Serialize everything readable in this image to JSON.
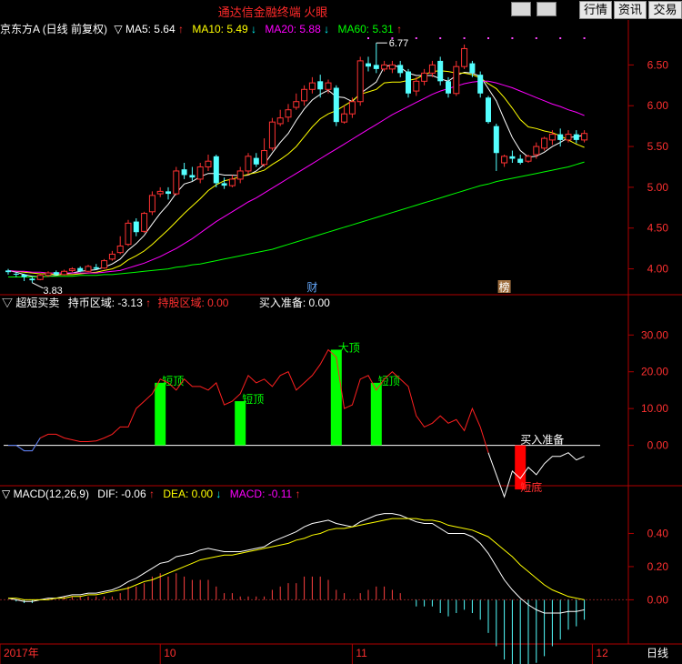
{
  "app": {
    "title": "通达信金融终端  火眼",
    "buttons": [
      "行情",
      "资讯",
      "交易"
    ]
  },
  "chart_data": [
    {
      "type": "candlestick",
      "panel": "price",
      "header": {
        "name": "京东方A",
        "period": "(日线 前复权)",
        "ma5": "MA5: 5.64",
        "ma10": "MA10: 5.49",
        "ma20": "MA20: 5.88",
        "ma60": "MA60: 5.31"
      },
      "ylim": [
        3.75,
        6.85
      ],
      "yticks": [
        "6.50",
        "6.00",
        "5.50",
        "5.00",
        "4.50",
        "4.00"
      ],
      "ytick_values": [
        6.5,
        6.0,
        5.5,
        5.0,
        4.5,
        4.0
      ],
      "high_label": "6.77",
      "low_label": "3.83",
      "markers": [
        "财",
        "榜"
      ],
      "candles": [
        [
          3.98,
          3.96,
          4.0,
          3.93
        ],
        [
          3.94,
          3.93,
          3.96,
          3.9
        ],
        [
          3.93,
          3.9,
          3.94,
          3.85
        ],
        [
          3.88,
          3.86,
          3.9,
          3.83
        ],
        [
          3.87,
          3.92,
          3.94,
          3.86
        ],
        [
          3.92,
          3.95,
          3.97,
          3.9
        ],
        [
          3.96,
          3.93,
          3.98,
          3.92
        ],
        [
          3.93,
          3.97,
          3.99,
          3.92
        ],
        [
          3.98,
          4.0,
          4.02,
          3.96
        ],
        [
          4.01,
          3.97,
          4.03,
          3.96
        ],
        [
          3.97,
          4.03,
          4.05,
          3.96
        ],
        [
          4.02,
          4.0,
          4.06,
          3.99
        ],
        [
          4.01,
          4.1,
          4.12,
          4.0
        ],
        [
          4.12,
          4.18,
          4.22,
          4.1
        ],
        [
          4.2,
          4.28,
          4.4,
          4.18
        ],
        [
          4.3,
          4.56,
          4.6,
          4.28
        ],
        [
          4.58,
          4.45,
          4.62,
          4.4
        ],
        [
          4.46,
          4.68,
          4.7,
          4.44
        ],
        [
          4.7,
          4.9,
          4.95,
          4.66
        ],
        [
          4.92,
          4.95,
          5.0,
          4.88
        ],
        [
          4.95,
          4.92,
          5.0,
          4.85
        ],
        [
          4.92,
          5.2,
          5.25,
          4.9
        ],
        [
          5.22,
          5.15,
          5.3,
          5.1
        ],
        [
          5.15,
          5.12,
          5.25,
          5.08
        ],
        [
          5.1,
          5.25,
          5.3,
          5.05
        ],
        [
          5.25,
          5.32,
          5.4,
          5.2
        ],
        [
          5.38,
          5.05,
          5.4,
          5.0
        ],
        [
          5.05,
          5.02,
          5.12,
          4.98
        ],
        [
          5.02,
          5.1,
          5.15,
          5.0
        ],
        [
          5.1,
          5.2,
          5.25,
          5.05
        ],
        [
          5.2,
          5.38,
          5.42,
          5.15
        ],
        [
          5.36,
          5.28,
          5.42,
          5.25
        ],
        [
          5.28,
          5.45,
          5.6,
          5.25
        ],
        [
          5.48,
          5.8,
          5.85,
          5.45
        ],
        [
          5.78,
          5.85,
          5.95,
          5.75
        ],
        [
          5.86,
          5.95,
          6.02,
          5.8
        ],
        [
          5.98,
          6.05,
          6.15,
          5.95
        ],
        [
          6.06,
          6.2,
          6.25,
          6.0
        ],
        [
          6.2,
          6.28,
          6.35,
          6.15
        ],
        [
          6.3,
          6.2,
          6.38,
          6.1
        ],
        [
          6.2,
          6.28,
          6.32,
          6.15
        ],
        [
          6.22,
          5.8,
          6.25,
          5.75
        ],
        [
          5.8,
          5.9,
          6.0,
          5.78
        ],
        [
          5.9,
          6.05,
          6.1,
          5.85
        ],
        [
          6.05,
          6.55,
          6.6,
          6.0
        ],
        [
          6.52,
          6.48,
          6.6,
          6.42
        ],
        [
          6.5,
          6.45,
          6.77,
          6.4
        ],
        [
          6.45,
          6.5,
          6.55,
          6.42
        ],
        [
          6.45,
          6.5,
          6.55,
          6.4
        ],
        [
          6.5,
          6.4,
          6.55,
          6.35
        ],
        [
          6.42,
          6.15,
          6.45,
          6.1
        ],
        [
          6.18,
          6.3,
          6.35,
          6.12
        ],
        [
          6.3,
          6.4,
          6.45,
          6.25
        ],
        [
          6.4,
          6.5,
          6.55,
          6.35
        ],
        [
          6.55,
          6.3,
          6.6,
          6.25
        ],
        [
          6.3,
          6.15,
          6.35,
          6.1
        ],
        [
          6.15,
          6.48,
          6.55,
          6.12
        ],
        [
          6.48,
          6.7,
          6.75,
          6.45
        ],
        [
          6.52,
          6.4,
          6.55,
          6.35
        ],
        [
          6.38,
          6.15,
          6.42,
          6.1
        ],
        [
          6.1,
          5.8,
          6.12,
          5.78
        ],
        [
          5.75,
          5.42,
          5.78,
          5.2
        ],
        [
          5.3,
          5.38,
          5.4,
          5.25
        ],
        [
          5.38,
          5.35,
          5.45,
          5.3
        ],
        [
          5.35,
          5.3,
          5.4,
          5.28
        ],
        [
          5.32,
          5.38,
          5.4,
          5.3
        ],
        [
          5.4,
          5.5,
          5.55,
          5.35
        ],
        [
          5.48,
          5.6,
          5.62,
          5.45
        ],
        [
          5.58,
          5.65,
          5.7,
          5.52
        ],
        [
          5.65,
          5.58,
          5.72,
          5.5
        ],
        [
          5.58,
          5.65,
          5.7,
          5.55
        ],
        [
          5.65,
          5.58,
          5.7,
          5.54
        ],
        [
          5.58,
          5.66,
          5.7,
          5.55
        ]
      ],
      "series": [
        {
          "name": "MA5",
          "color": "#ffffff",
          "values": [
            3.98,
            3.96,
            3.93,
            3.91,
            3.9,
            3.91,
            3.92,
            3.94,
            3.95,
            3.97,
            3.98,
            3.99,
            4.02,
            4.06,
            4.12,
            4.23,
            4.31,
            4.41,
            4.55,
            4.68,
            4.79,
            4.93,
            5.04,
            5.07,
            5.13,
            5.17,
            5.17,
            5.15,
            5.15,
            5.14,
            5.15,
            5.2,
            5.28,
            5.42,
            5.55,
            5.66,
            5.82,
            5.96,
            6.07,
            6.14,
            6.19,
            6.11,
            6.1,
            6.05,
            6.15,
            6.22,
            6.29,
            6.48,
            6.5,
            6.47,
            6.4,
            6.37,
            6.37,
            6.37,
            6.33,
            6.3,
            6.37,
            6.41,
            6.4,
            6.36,
            6.21,
            6.06,
            5.83,
            5.61,
            5.45,
            5.37,
            5.38,
            5.43,
            5.5,
            5.55,
            5.61,
            5.62,
            5.64
          ]
        },
        {
          "name": "MA10",
          "color": "#ffff00",
          "values": [
            3.98,
            3.97,
            3.96,
            3.95,
            3.94,
            3.94,
            3.93,
            3.93,
            3.93,
            3.94,
            3.95,
            3.96,
            3.98,
            4.0,
            4.04,
            4.11,
            4.16,
            4.22,
            4.3,
            4.39,
            4.48,
            4.58,
            4.68,
            4.77,
            4.86,
            4.96,
            5.03,
            5.08,
            5.1,
            5.13,
            5.16,
            5.18,
            5.21,
            5.28,
            5.34,
            5.41,
            5.5,
            5.62,
            5.74,
            5.84,
            5.9,
            5.94,
            6.0,
            6.06,
            6.14,
            6.17,
            6.2,
            6.28,
            6.29,
            6.29,
            6.31,
            6.33,
            6.38,
            6.42,
            6.43,
            6.42,
            6.4,
            6.4,
            6.38,
            6.34,
            6.27,
            6.21,
            6.1,
            5.97,
            5.83,
            5.74,
            5.72,
            5.69,
            5.67,
            5.63,
            5.58,
            5.53,
            5.49
          ]
        },
        {
          "name": "MA20",
          "color": "#ff00ff",
          "values": [
            3.98,
            3.97,
            3.97,
            3.96,
            3.96,
            3.95,
            3.95,
            3.95,
            3.95,
            3.95,
            3.95,
            3.95,
            3.96,
            3.97,
            3.98,
            4.01,
            4.04,
            4.07,
            4.11,
            4.15,
            4.2,
            4.25,
            4.31,
            4.37,
            4.44,
            4.51,
            4.58,
            4.64,
            4.7,
            4.76,
            4.82,
            4.87,
            4.93,
            4.99,
            5.05,
            5.11,
            5.17,
            5.23,
            5.29,
            5.35,
            5.41,
            5.47,
            5.53,
            5.59,
            5.65,
            5.71,
            5.77,
            5.83,
            5.89,
            5.94,
            5.99,
            6.04,
            6.09,
            6.14,
            6.18,
            6.21,
            6.24,
            6.27,
            6.29,
            6.3,
            6.3,
            6.28,
            6.25,
            6.22,
            6.18,
            6.14,
            6.1,
            6.06,
            6.02,
            5.99,
            5.95,
            5.92,
            5.88
          ]
        },
        {
          "name": "MA60",
          "color": "#00ff00",
          "values": [
            3.9,
            3.9,
            3.9,
            3.9,
            3.9,
            3.91,
            3.91,
            3.91,
            3.91,
            3.92,
            3.92,
            3.92,
            3.93,
            3.93,
            3.94,
            3.95,
            3.96,
            3.97,
            3.98,
            3.99,
            4.0,
            4.02,
            4.03,
            4.05,
            4.06,
            4.08,
            4.1,
            4.12,
            4.14,
            4.16,
            4.18,
            4.2,
            4.22,
            4.24,
            4.27,
            4.3,
            4.33,
            4.36,
            4.39,
            4.42,
            4.45,
            4.48,
            4.51,
            4.54,
            4.57,
            4.6,
            4.63,
            4.66,
            4.69,
            4.72,
            4.75,
            4.78,
            4.81,
            4.84,
            4.87,
            4.9,
            4.93,
            4.96,
            4.99,
            5.02,
            5.04,
            5.07,
            5.09,
            5.11,
            5.13,
            5.15,
            5.17,
            5.19,
            5.21,
            5.23,
            5.25,
            5.28,
            5.31
          ]
        }
      ]
    },
    {
      "type": "line-bar",
      "panel": "indicator",
      "header": {
        "name": "超短买卖",
        "holding": "持币区域: -3.13",
        "share_zone": "持股区域: 0.00",
        "buy_ready": "买入准备: 0.00"
      },
      "ylim": [
        -10,
        37
      ],
      "yticks": [
        "30.00",
        "20.00",
        "10.00",
        "0.00"
      ],
      "ytick_values": [
        30,
        20,
        10,
        0
      ],
      "line": [
        0,
        0,
        -1.5,
        -1.5,
        2,
        3,
        3,
        2,
        1.5,
        1,
        1,
        1.2,
        2,
        3,
        5,
        5,
        10,
        12,
        14,
        18,
        17,
        15,
        18,
        16,
        16,
        15,
        17,
        11,
        12,
        14,
        19,
        17,
        18,
        16,
        19,
        20,
        15,
        17,
        19,
        22,
        26,
        24,
        10,
        11,
        18,
        19,
        15,
        18,
        20,
        18,
        16,
        8,
        5,
        6,
        8,
        6,
        7,
        4,
        10,
        5,
        -2,
        -8,
        -14,
        -7,
        -9,
        -6,
        -8,
        -5,
        -3,
        -3,
        -2,
        -4,
        -3
      ],
      "bars": [
        {
          "index": 19,
          "value": 17,
          "color": "#00ff00",
          "label": "短顶"
        },
        {
          "index": 29,
          "value": 12,
          "color": "#00ff00",
          "label": "短顶"
        },
        {
          "index": 41,
          "value": 26,
          "color": "#00ff00",
          "label": "大顶"
        },
        {
          "index": 46,
          "value": 17,
          "color": "#00ff00",
          "label": "短顶"
        },
        {
          "index": 64,
          "value": -12,
          "color": "#ff0000",
          "label": "短底"
        }
      ],
      "annotations": [
        "买入准备"
      ]
    },
    {
      "type": "macd",
      "panel": "macd",
      "header": {
        "name": "MACD(12,26,9)",
        "dif": "DIF: -0.06",
        "dea": "DEA: 0.00",
        "macd": "MACD: -0.11"
      },
      "ylim": [
        -0.25,
        0.6
      ],
      "yticks": [
        "0.40",
        "0.20",
        "0.00"
      ],
      "ytick_values": [
        0.4,
        0.2,
        0.0
      ],
      "dif": [
        0.01,
        0.0,
        -0.01,
        -0.01,
        0.0,
        0.01,
        0.01,
        0.02,
        0.03,
        0.03,
        0.04,
        0.04,
        0.05,
        0.06,
        0.08,
        0.11,
        0.13,
        0.16,
        0.19,
        0.22,
        0.23,
        0.26,
        0.27,
        0.28,
        0.3,
        0.31,
        0.3,
        0.29,
        0.29,
        0.29,
        0.3,
        0.31,
        0.32,
        0.35,
        0.37,
        0.39,
        0.41,
        0.44,
        0.46,
        0.47,
        0.48,
        0.46,
        0.45,
        0.44,
        0.47,
        0.49,
        0.51,
        0.52,
        0.52,
        0.51,
        0.49,
        0.47,
        0.46,
        0.46,
        0.43,
        0.4,
        0.4,
        0.4,
        0.38,
        0.34,
        0.28,
        0.2,
        0.12,
        0.06,
        0.01,
        -0.03,
        -0.06,
        -0.08,
        -0.08,
        -0.08,
        -0.07,
        -0.07,
        -0.06
      ],
      "dea": [
        0.01,
        0.01,
        0.0,
        0.0,
        0.0,
        0.0,
        0.01,
        0.01,
        0.02,
        0.02,
        0.03,
        0.03,
        0.04,
        0.05,
        0.06,
        0.07,
        0.09,
        0.11,
        0.12,
        0.14,
        0.16,
        0.18,
        0.2,
        0.22,
        0.24,
        0.25,
        0.26,
        0.27,
        0.27,
        0.28,
        0.29,
        0.3,
        0.31,
        0.32,
        0.33,
        0.34,
        0.36,
        0.37,
        0.39,
        0.4,
        0.42,
        0.43,
        0.43,
        0.44,
        0.45,
        0.46,
        0.47,
        0.48,
        0.49,
        0.49,
        0.49,
        0.49,
        0.48,
        0.48,
        0.47,
        0.45,
        0.44,
        0.43,
        0.42,
        0.4,
        0.38,
        0.34,
        0.3,
        0.26,
        0.21,
        0.17,
        0.13,
        0.09,
        0.06,
        0.04,
        0.02,
        0.01,
        0.0
      ],
      "macd": [
        0.0,
        -0.01,
        -0.02,
        -0.02,
        0.0,
        0.01,
        0.0,
        0.02,
        0.02,
        0.02,
        0.02,
        0.02,
        0.02,
        0.02,
        0.04,
        0.08,
        0.08,
        0.1,
        0.14,
        0.16,
        0.14,
        0.16,
        0.14,
        0.12,
        0.12,
        0.12,
        0.08,
        0.04,
        0.04,
        0.02,
        0.02,
        0.02,
        0.02,
        0.06,
        0.08,
        0.1,
        0.1,
        0.14,
        0.14,
        0.14,
        0.12,
        0.06,
        0.04,
        0.0,
        0.04,
        0.06,
        0.08,
        0.08,
        0.06,
        0.04,
        0.0,
        -0.04,
        -0.04,
        -0.04,
        -0.08,
        -0.1,
        -0.08,
        -0.06,
        -0.08,
        -0.12,
        -0.2,
        -0.28,
        -0.36,
        -0.4,
        -0.4,
        -0.4,
        -0.38,
        -0.34,
        -0.28,
        -0.24,
        -0.18,
        -0.16,
        -0.12
      ]
    }
  ],
  "xaxis": {
    "labels": [
      "2017年",
      "10",
      "11",
      "12"
    ],
    "label_index": [
      0,
      19,
      43,
      73
    ],
    "period_label": "日线"
  }
}
